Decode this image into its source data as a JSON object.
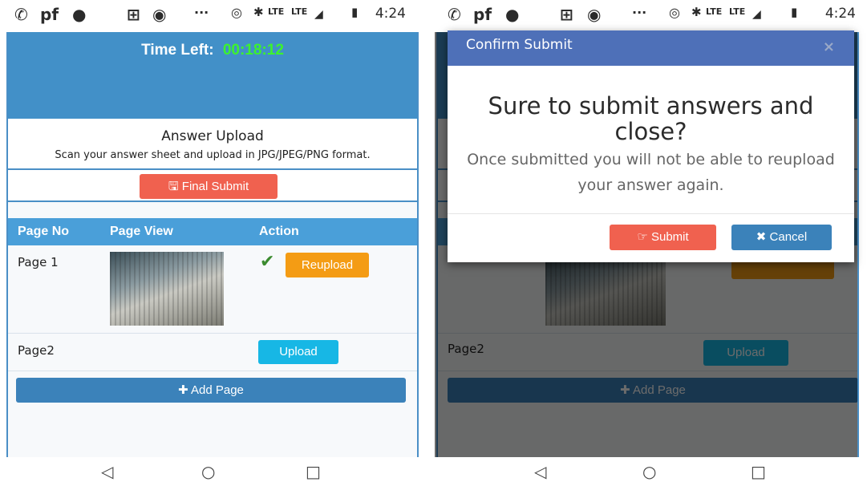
{
  "status_bar": {
    "carrier": "pf",
    "net_lte1": "LTE",
    "net_lte2": "LTE",
    "time": "4:24"
  },
  "exam": {
    "time_left_label": "Time Left:",
    "timer": "00:18:12",
    "heading": "Answer Upload",
    "instructions": "Scan your answer sheet and upload in JPG/JPEG/PNG format.",
    "final_submit": "Final Submit"
  },
  "table": {
    "headers": [
      "Page No",
      "Page View",
      "Action"
    ],
    "rows": [
      {
        "label": "Page 1",
        "action": "Reupload",
        "uploaded": true
      },
      {
        "label": "Page2",
        "action": "Upload",
        "uploaded": false
      }
    ],
    "add_page": "Add Page"
  },
  "modal": {
    "title": "Confirm Submit",
    "close": "×",
    "question": "Sure to submit answers and close?",
    "info": "Once submitted you will not be able to reupload your answer again.",
    "submit": "Submit",
    "cancel": "Cancel"
  },
  "colors": {
    "header_blue": "#4290c8",
    "timer_green": "#3cf22e",
    "submit_red": "#f0614f",
    "reupload_orange": "#f49c14",
    "upload_cyan": "#17b7e5",
    "modal_header": "#4e70b8"
  },
  "icons": {
    "whatsapp": "whatsapp-icon",
    "phone": "phone-icon",
    "save": "save-icon",
    "check": "check-icon",
    "plus": "plus-icon",
    "thumbs": "hand-point-icon",
    "close": "x-icon",
    "back": "back-icon",
    "home": "home-icon",
    "recents": "recents-icon"
  }
}
